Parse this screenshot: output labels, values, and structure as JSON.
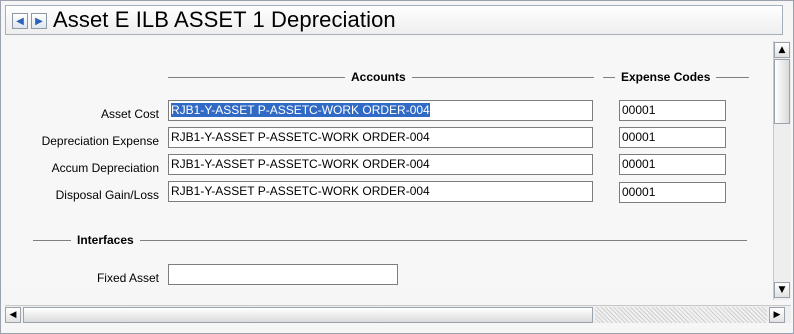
{
  "window": {
    "title": "Asset E ILB ASSET 1 Depreciation",
    "nav_prev_icon": "◀",
    "nav_next_icon": "▶"
  },
  "accounts_section": {
    "accounts_header": "Accounts",
    "expense_codes_header": "Expense Codes",
    "rows": [
      {
        "label": "Asset Cost",
        "account": "RJB1-Y-ASSET P-ASSETC-WORK ORDER-004",
        "expense_code": "00001",
        "selected": true
      },
      {
        "label": "Depreciation Expense",
        "account": "RJB1-Y-ASSET P-ASSETC-WORK ORDER-004",
        "expense_code": "00001"
      },
      {
        "label": "Accum Depreciation",
        "account": "RJB1-Y-ASSET P-ASSETC-WORK ORDER-004",
        "expense_code": "00001"
      },
      {
        "label": "Disposal Gain/Loss",
        "account": "RJB1-Y-ASSET P-ASSETC-WORK ORDER-004",
        "expense_code": "00001"
      }
    ]
  },
  "interfaces_section": {
    "header": "Interfaces",
    "fixed_asset_label": "Fixed Asset",
    "fixed_asset_value": ""
  },
  "scrollbars": {
    "up_icon": "▲",
    "down_icon": "▼",
    "left_icon": "◀",
    "right_icon": "▶"
  },
  "colors": {
    "selection": "#316ac5",
    "nav_arrow": "#2d62b8"
  }
}
